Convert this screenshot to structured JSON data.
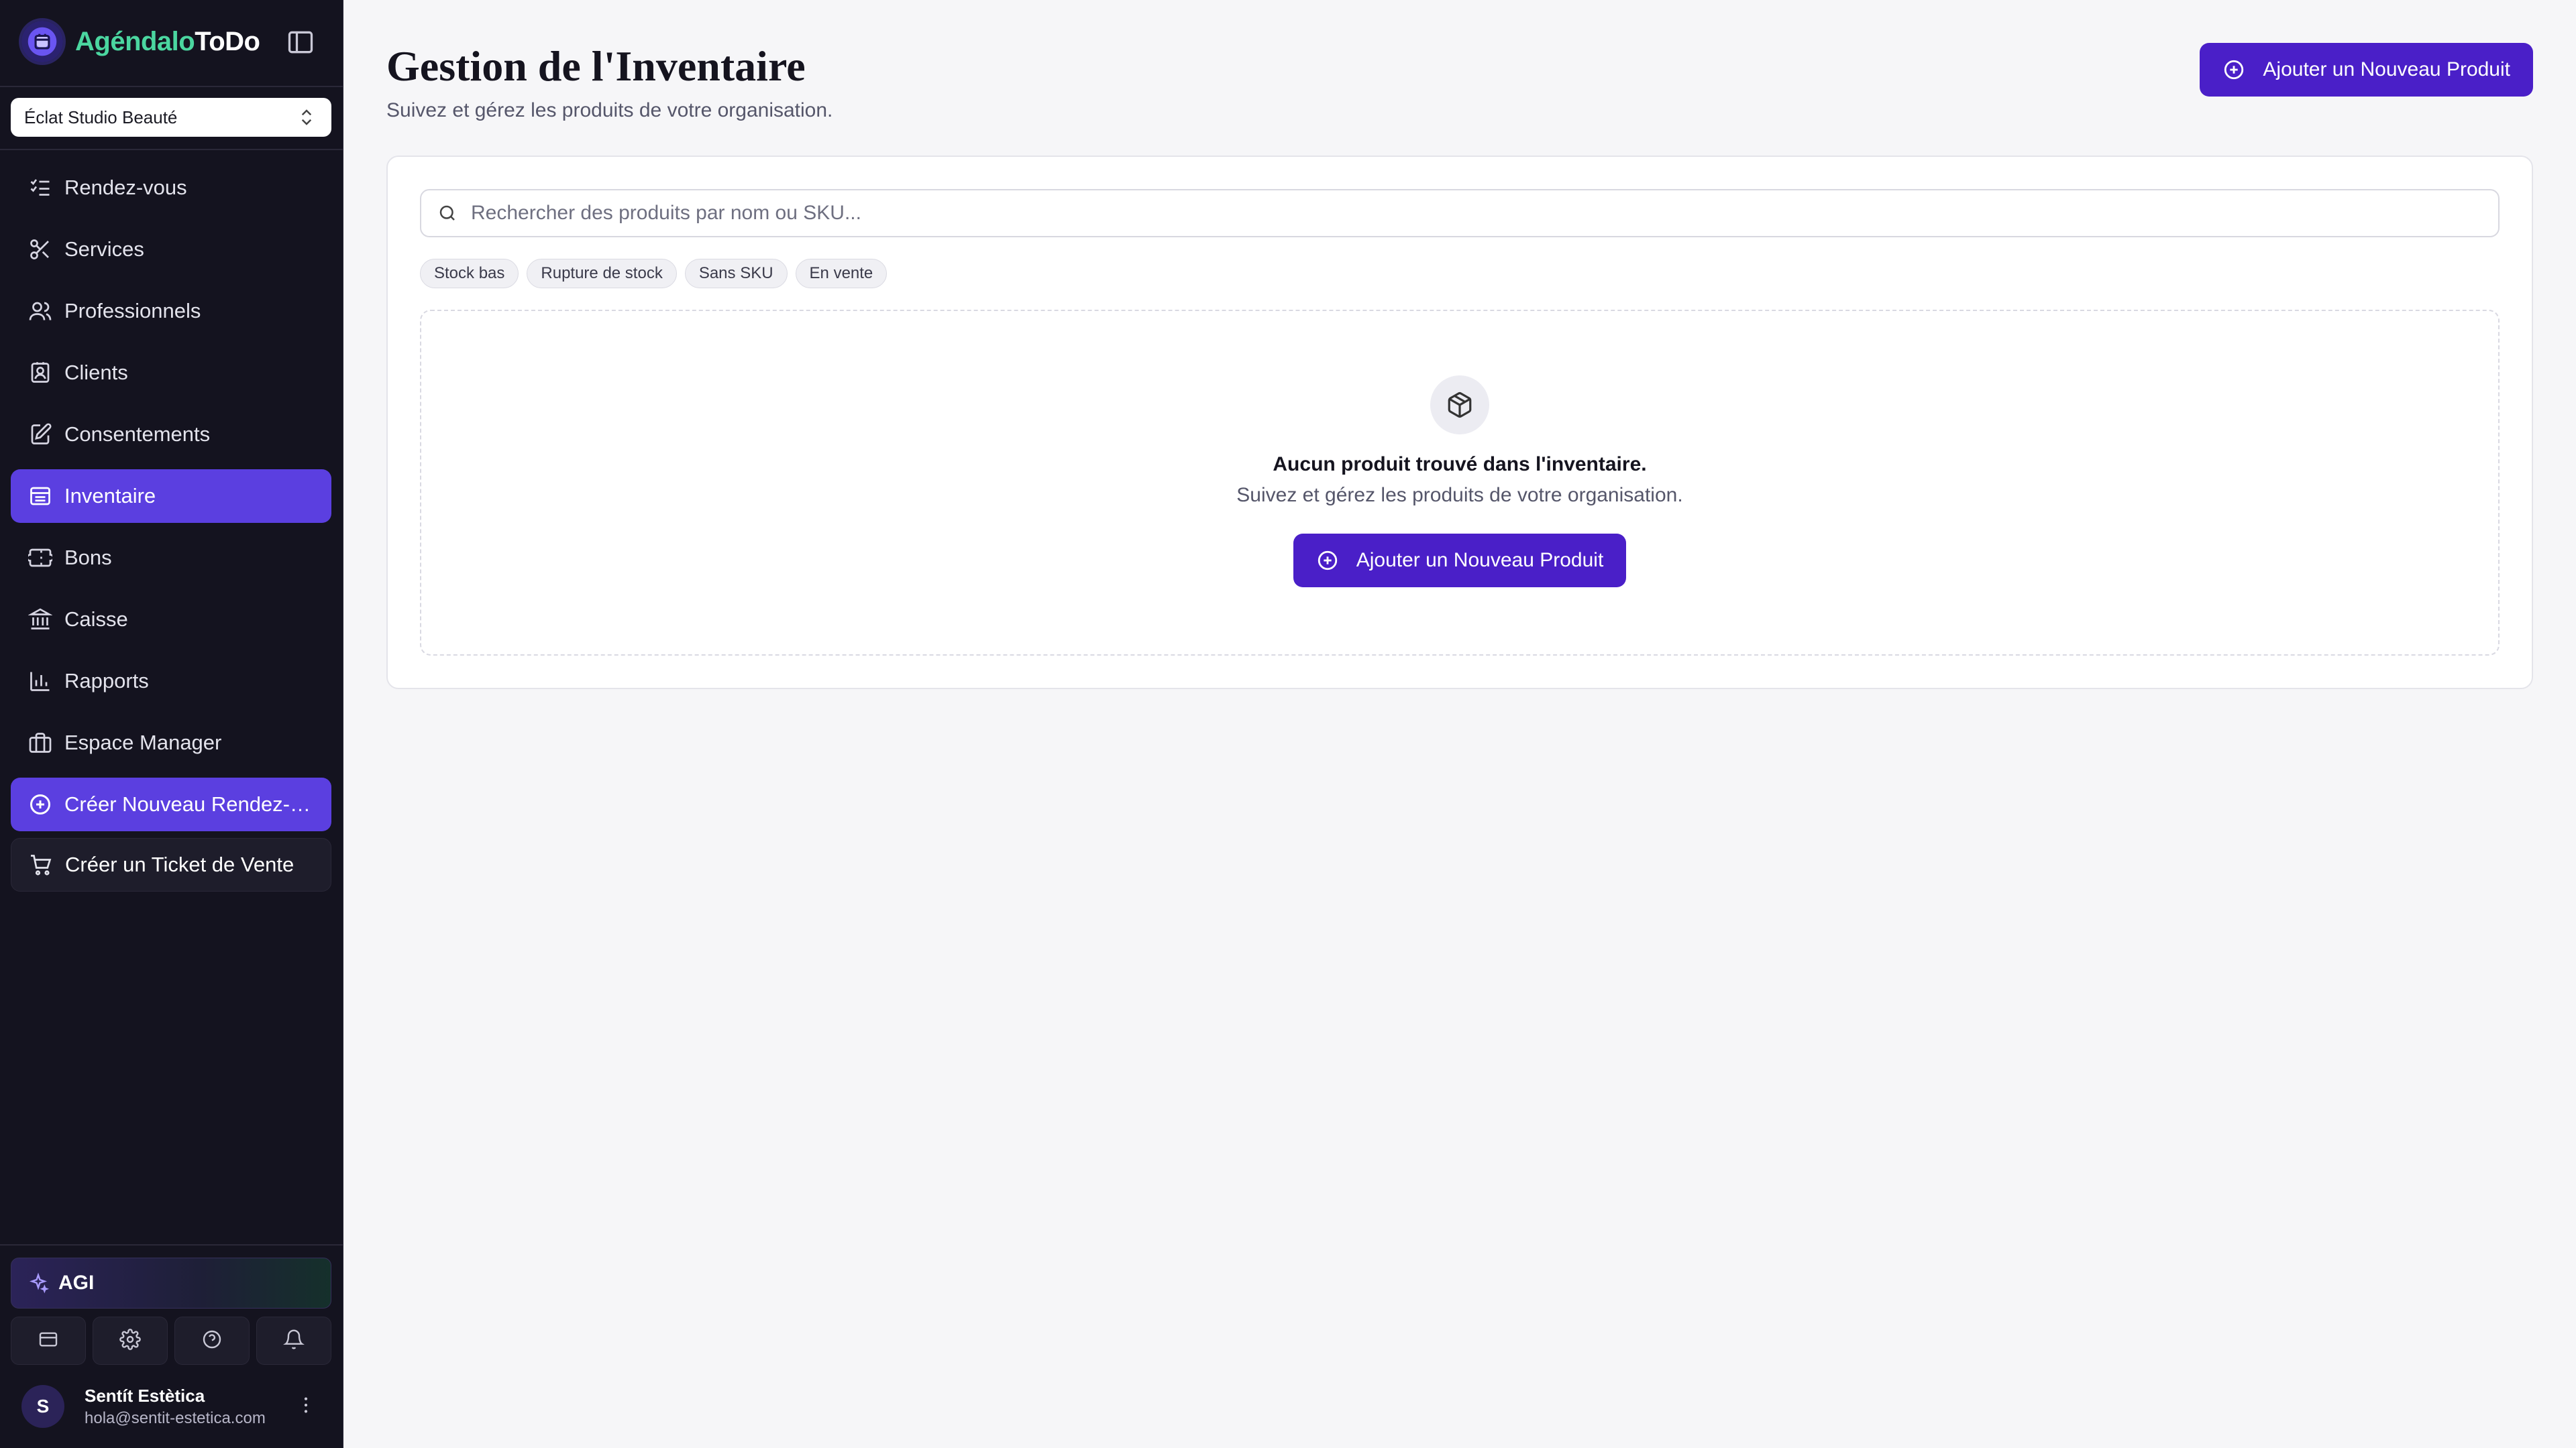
{
  "brand": {
    "name_part1": "Agéndalo",
    "name_part2": "ToDo"
  },
  "organization": {
    "selected": "Éclat Studio Beauté"
  },
  "sidebar": {
    "items": [
      {
        "label": "Rendez-vous",
        "icon": "list-checks-icon"
      },
      {
        "label": "Services",
        "icon": "scissors-icon"
      },
      {
        "label": "Professionnels",
        "icon": "users-icon"
      },
      {
        "label": "Clients",
        "icon": "contact-icon"
      },
      {
        "label": "Consentements",
        "icon": "file-signature-icon"
      },
      {
        "label": "Inventaire",
        "icon": "archive-icon",
        "active": true
      },
      {
        "label": "Bons",
        "icon": "ticket-icon"
      },
      {
        "label": "Caisse",
        "icon": "bank-icon"
      },
      {
        "label": "Rapports",
        "icon": "bar-chart-icon"
      },
      {
        "label": "Espace Manager",
        "icon": "briefcase-icon"
      }
    ],
    "cta_new_appointment": "Créer Nouveau Rendez-vous",
    "cta_sale_ticket": "Créer un Ticket de Vente",
    "agi_label": "AGI",
    "tools": [
      "credit-card-icon",
      "gear-icon",
      "help-icon",
      "bell-icon"
    ]
  },
  "user": {
    "initial": "S",
    "name": "Sentít Estètica",
    "email": "hola@sentit-estetica.com"
  },
  "page": {
    "title": "Gestion de l'Inventaire",
    "subtitle": "Suivez et gérez les produits de votre organisation.",
    "add_button": "Ajouter un Nouveau Produit"
  },
  "search": {
    "placeholder": "Rechercher des produits par nom ou SKU..."
  },
  "filters": [
    "Stock bas",
    "Rupture de stock",
    "Sans SKU",
    "En vente"
  ],
  "empty_state": {
    "title": "Aucun produit trouvé dans l'inventaire.",
    "subtitle": "Suivez et gérez les produits de votre organisation.",
    "button": "Ajouter un Nouveau Produit"
  },
  "colors": {
    "sidebar_bg": "#14131f",
    "accent": "#5b3fe0",
    "primary_button": "#4a1fc8",
    "brand_green": "#4bd6a0"
  }
}
